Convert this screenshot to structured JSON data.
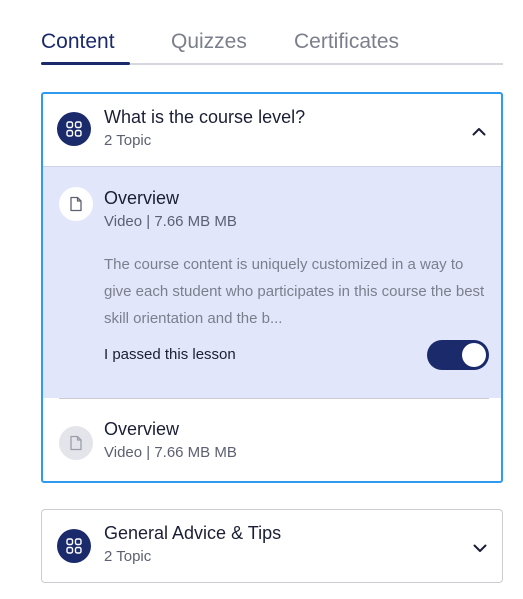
{
  "tabs": [
    {
      "label": "Content",
      "active": true
    },
    {
      "label": "Quizzes",
      "active": false
    },
    {
      "label": "Certificates",
      "active": false
    }
  ],
  "sections": [
    {
      "title": "What is the course level?",
      "subtitle": "2 Topic",
      "expanded": true,
      "icon": "grid-icon",
      "chevron": "chevron-up-icon",
      "lessons": [
        {
          "title": "Overview",
          "meta": "Video | 7.66 MB MB",
          "icon": "file-icon",
          "description": "The course content is uniquely customized in a way to give each student who participates in this course the best skill orientation and the b...",
          "pass_label": "I passed this lesson",
          "passed": true
        },
        {
          "title": "Overview",
          "meta": "Video | 7.66 MB MB",
          "icon": "file-icon"
        }
      ]
    },
    {
      "title": "General Advice & Tips",
      "subtitle": "2 Topic",
      "expanded": false,
      "icon": "grid-icon",
      "chevron": "chevron-down-icon"
    }
  ],
  "colors": {
    "primary": "#1b2a6b",
    "focus_border": "#2e9bf0",
    "active_lesson_bg": "#e2e6fa",
    "muted_text": "#7b7f8c"
  }
}
